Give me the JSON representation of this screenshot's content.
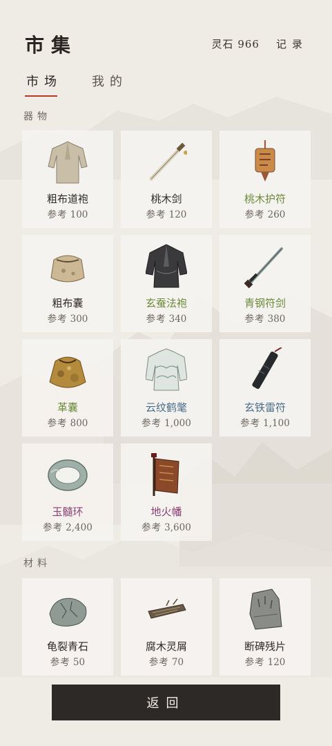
{
  "header": {
    "title": "市集",
    "stone_label": "灵石",
    "stone_value": "966",
    "records_label": "记录"
  },
  "tabs": [
    {
      "label": "市场",
      "active": true
    },
    {
      "label": "我的",
      "active": false
    }
  ],
  "price_label": "参考",
  "sections": {
    "items": {
      "label": "器物",
      "cards": [
        {
          "name": "粗布道袍",
          "price": "100",
          "quality": "common",
          "icon": "robe-icon"
        },
        {
          "name": "桃木剑",
          "price": "120",
          "quality": "common",
          "icon": "wooden-sword-icon"
        },
        {
          "name": "桃木护符",
          "price": "260",
          "quality": "fine",
          "icon": "talisman-icon"
        },
        {
          "name": "粗布囊",
          "price": "300",
          "quality": "common",
          "icon": "cloth-pouch-icon"
        },
        {
          "name": "玄蚕法袍",
          "price": "340",
          "quality": "fine",
          "icon": "dark-robe-icon"
        },
        {
          "name": "青钢符剑",
          "price": "380",
          "quality": "fine",
          "icon": "steel-sword-icon"
        },
        {
          "name": "革囊",
          "price": "800",
          "quality": "fine",
          "icon": "leather-pouch-icon"
        },
        {
          "name": "云纹鹤氅",
          "price": "1,000",
          "quality": "rare",
          "icon": "crane-cloak-icon"
        },
        {
          "name": "玄铁雷符",
          "price": "1,100",
          "quality": "rare",
          "icon": "iron-charm-icon"
        },
        {
          "name": "玉髓环",
          "price": "2,400",
          "quality": "epic",
          "icon": "jade-ring-icon"
        },
        {
          "name": "地火幡",
          "price": "3,600",
          "quality": "epic",
          "icon": "fire-banner-icon"
        }
      ]
    },
    "materials": {
      "label": "材料",
      "cards": [
        {
          "name": "龟裂青石",
          "price": "50",
          "quality": "common",
          "icon": "cracked-stone-icon"
        },
        {
          "name": "腐木灵屑",
          "price": "70",
          "quality": "common",
          "icon": "rotten-wood-icon"
        },
        {
          "name": "断碑残片",
          "price": "120",
          "quality": "common",
          "icon": "stele-fragment-icon"
        }
      ]
    }
  },
  "back_button": {
    "label": "返回"
  }
}
